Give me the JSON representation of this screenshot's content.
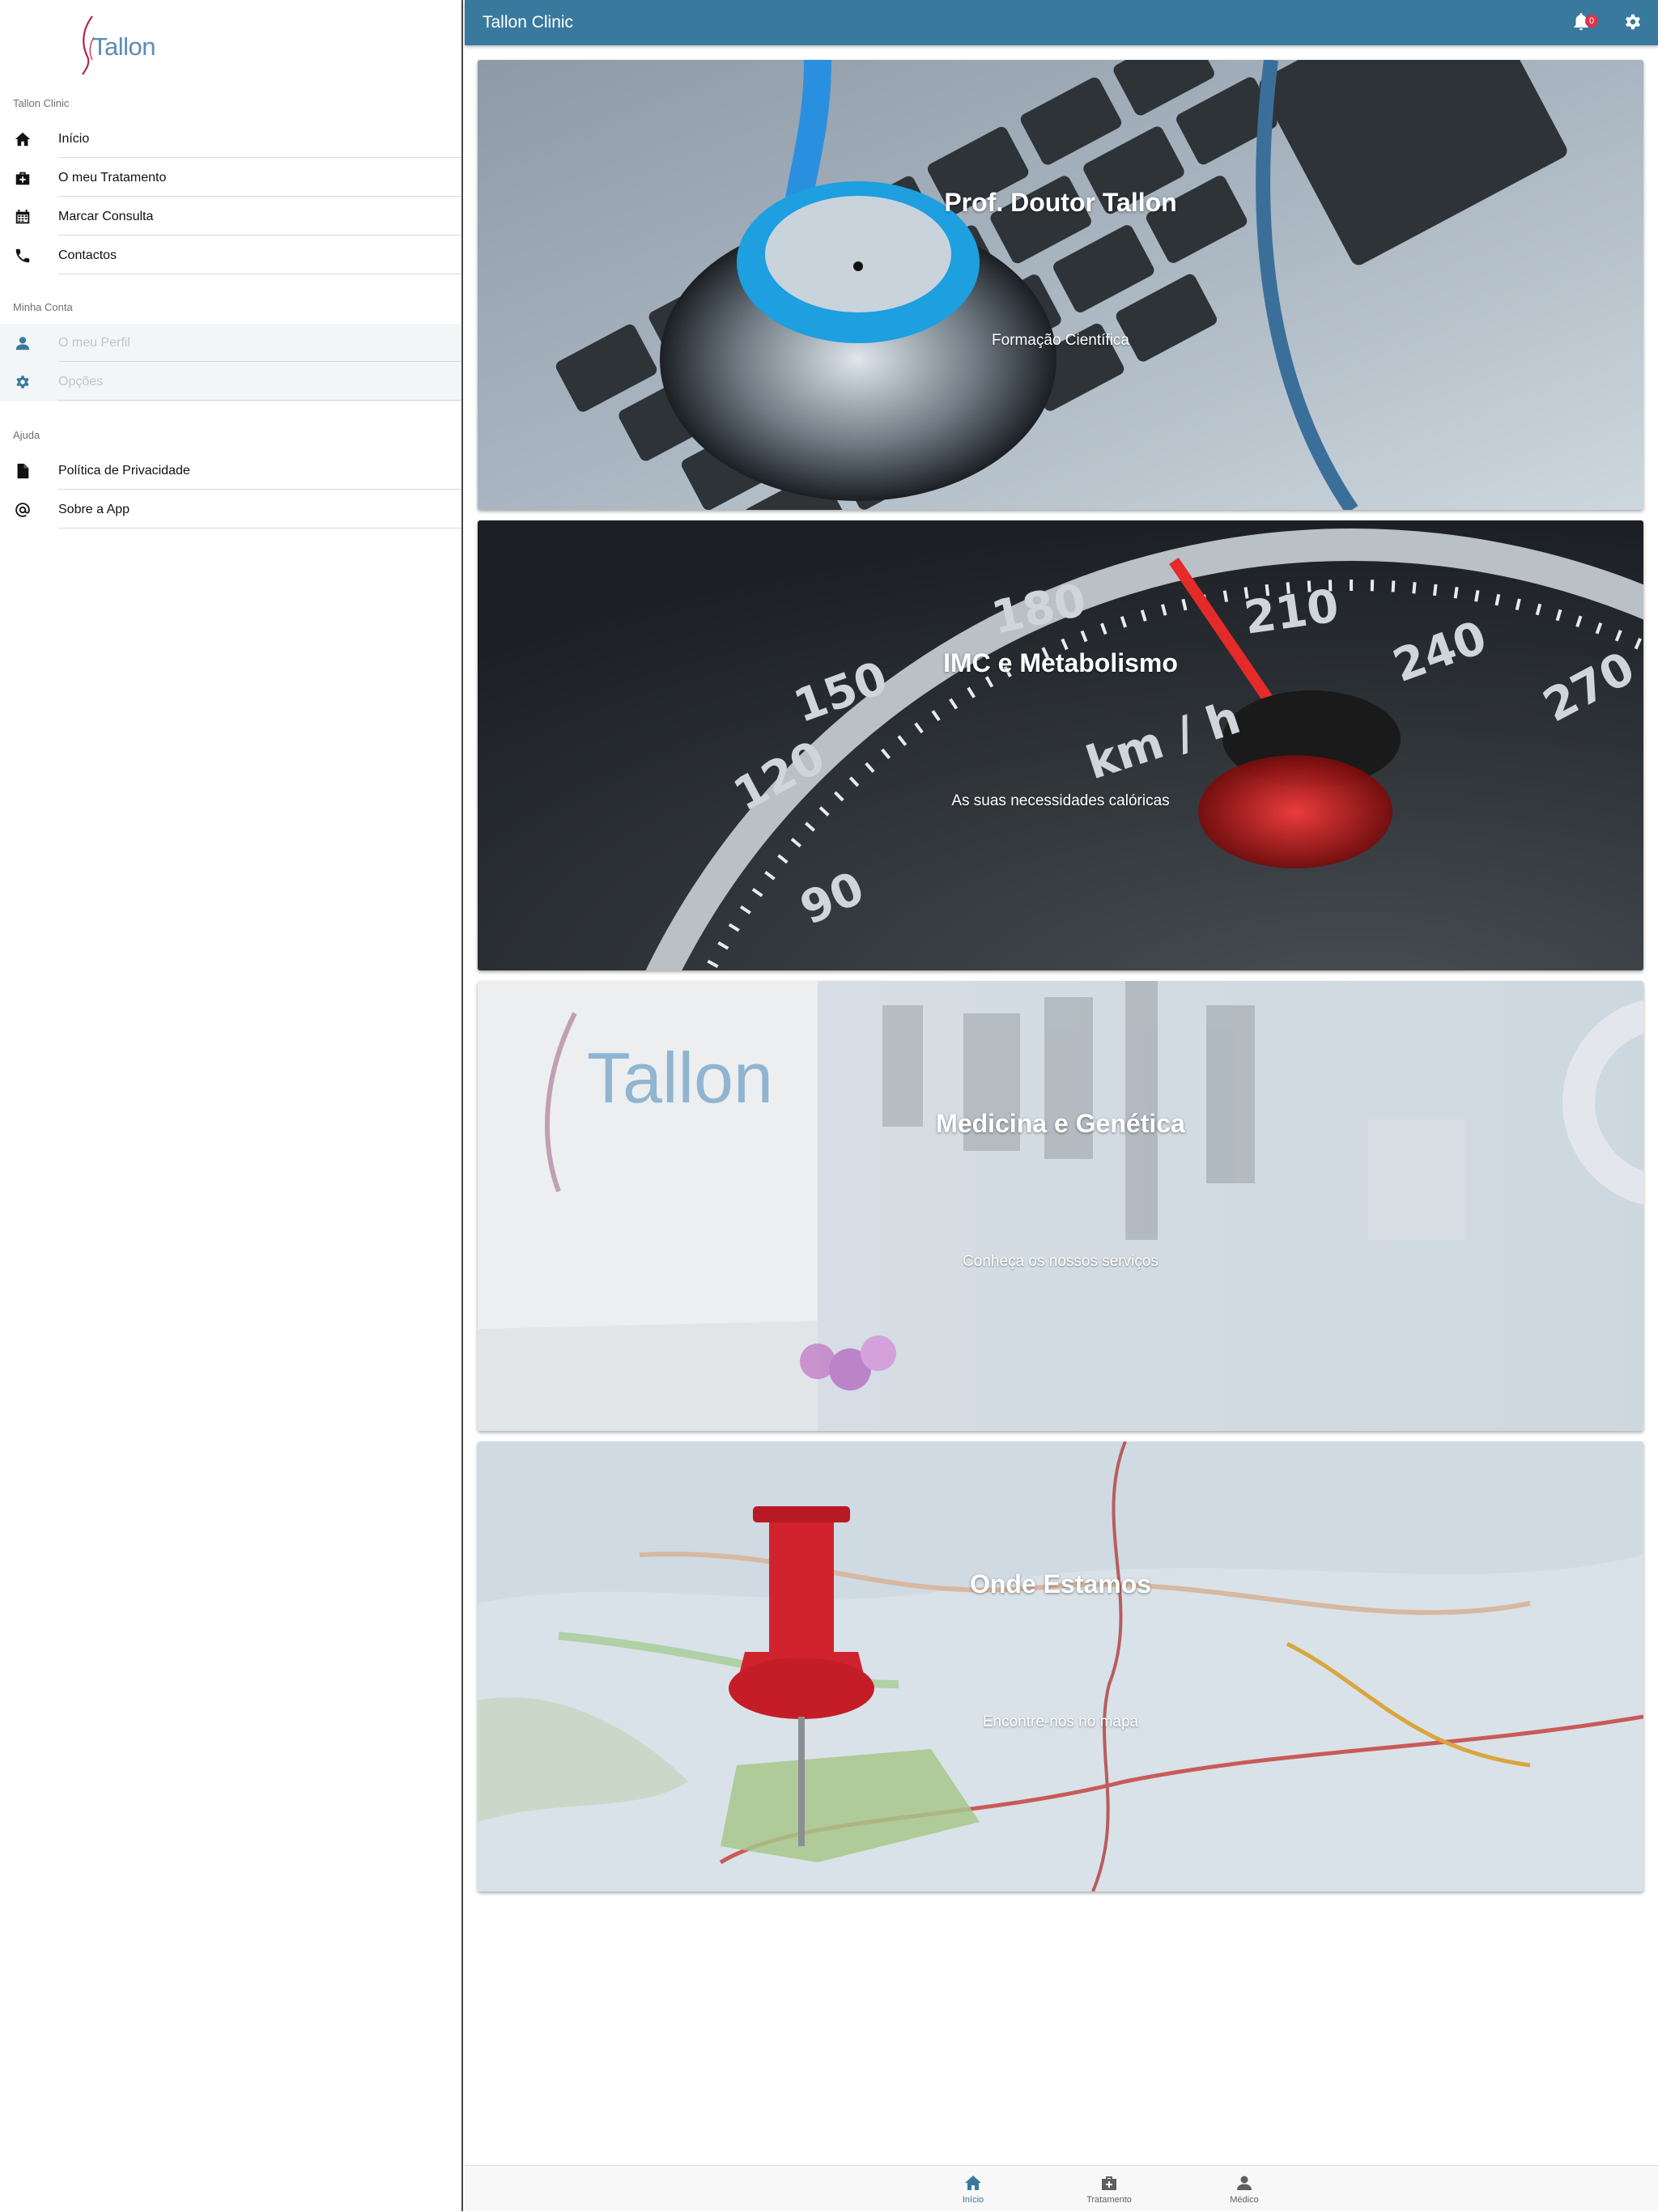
{
  "app": {
    "title": "Tallon Clinic",
    "logo_text": "Tallon"
  },
  "colors": {
    "primary": "#39799e",
    "badge": "#e0334a"
  },
  "sidebar": {
    "sections": [
      {
        "header": "Tallon Clinic"
      },
      {
        "header": "Minha Conta"
      },
      {
        "header": "Ajuda"
      }
    ],
    "items": [
      {
        "label": "Início",
        "icon": "home-icon",
        "enabled": true
      },
      {
        "label": "O meu Tratamento",
        "icon": "medical-bag-icon",
        "enabled": true
      },
      {
        "label": "Marcar Consulta",
        "icon": "calendar-icon",
        "enabled": true
      },
      {
        "label": "Contactos",
        "icon": "phone-icon",
        "enabled": true
      },
      {
        "label": "O meu Perfil",
        "icon": "person-icon",
        "enabled": false
      },
      {
        "label": "Opções",
        "icon": "gear-icon",
        "enabled": false
      },
      {
        "label": "Política de Privacidade",
        "icon": "document-icon",
        "enabled": true
      },
      {
        "label": "Sobre a App",
        "icon": "at-icon",
        "enabled": true
      }
    ]
  },
  "toolbar": {
    "title": "Tallon Clinic",
    "notifications_count": "0",
    "notifications_icon": "bell-icon",
    "settings_icon": "gear-icon"
  },
  "cards": [
    {
      "title": "Prof. Doutor Tallon",
      "subtitle": "Formação Científica",
      "image": "stethoscope-on-laptop"
    },
    {
      "title": "IMC e Metabolismo",
      "subtitle": "As suas necessidades calóricas",
      "image": "speedometer"
    },
    {
      "title": "Medicina e Genética",
      "subtitle": "Conheça os nossos serviços",
      "image": "clinic-interior"
    },
    {
      "title": "Onde Estamos",
      "subtitle": "Encontre-nos no mapa",
      "image": "map-with-pin"
    }
  ],
  "tabs": [
    {
      "label": "Início",
      "icon": "home-icon",
      "active": true
    },
    {
      "label": "Tratamento",
      "icon": "medical-bag-icon",
      "active": false
    },
    {
      "label": "Médico",
      "icon": "person-icon",
      "active": false
    }
  ]
}
